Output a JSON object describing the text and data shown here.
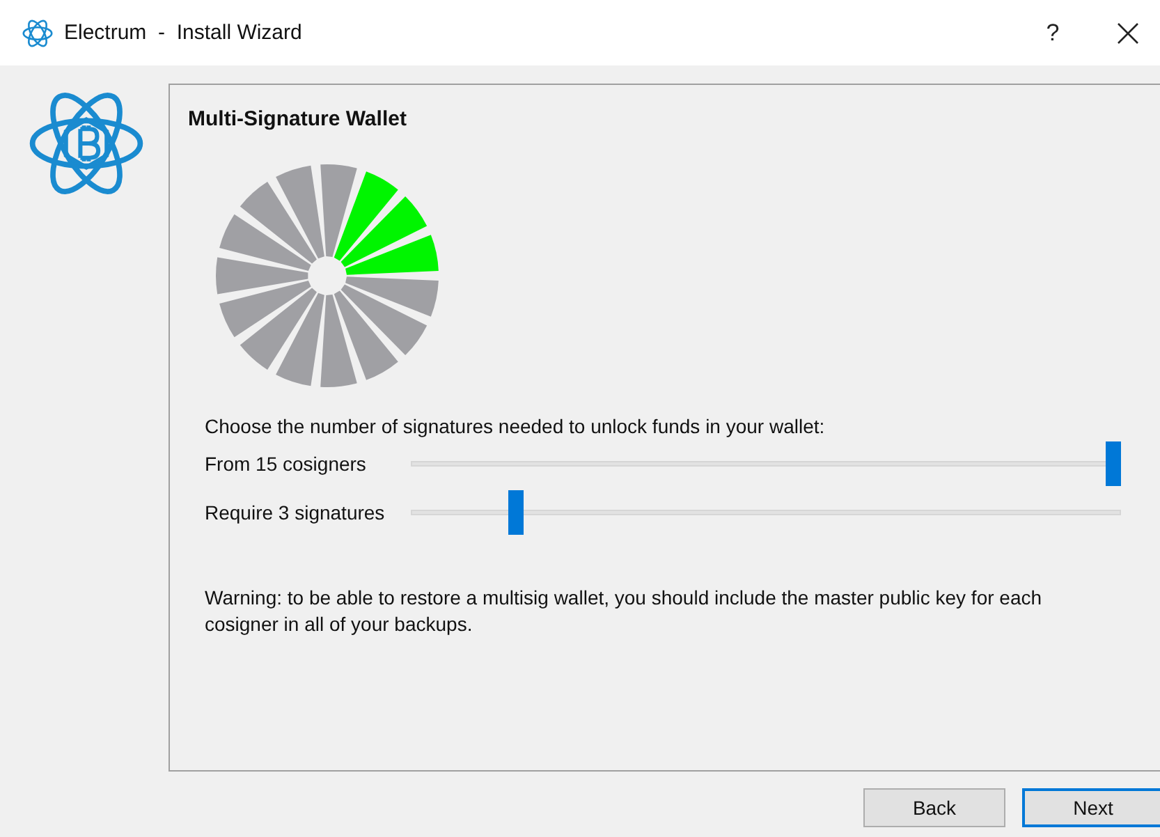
{
  "window": {
    "title": "Electrum  -  Install Wizard",
    "help": "?"
  },
  "page": {
    "title": "Multi-Signature Wallet",
    "wheel": [
      {
        "selected": true
      },
      {
        "selected": true
      },
      {
        "selected": true
      },
      {
        "selected": false
      },
      {
        "selected": false
      },
      {
        "selected": false
      },
      {
        "selected": false
      },
      {
        "selected": false
      },
      {
        "selected": false
      },
      {
        "selected": false
      },
      {
        "selected": false
      },
      {
        "selected": false
      },
      {
        "selected": false
      },
      {
        "selected": false
      },
      {
        "selected": false
      }
    ],
    "instruction": "Choose the number of signatures needed to unlock funds in your wallet:",
    "sliders": [
      {
        "label": "From 15 cosigners",
        "level": 1.0
      },
      {
        "label": "Require 3 signatures",
        "level": 0.14
      }
    ],
    "warning": "Warning: to be able to restore a multisig wallet, you should include the master public key for each cosigner in all of your backups."
  },
  "buttons": [
    {
      "label": "Back",
      "selected": false
    },
    {
      "label": "Next",
      "selected": true
    }
  ]
}
